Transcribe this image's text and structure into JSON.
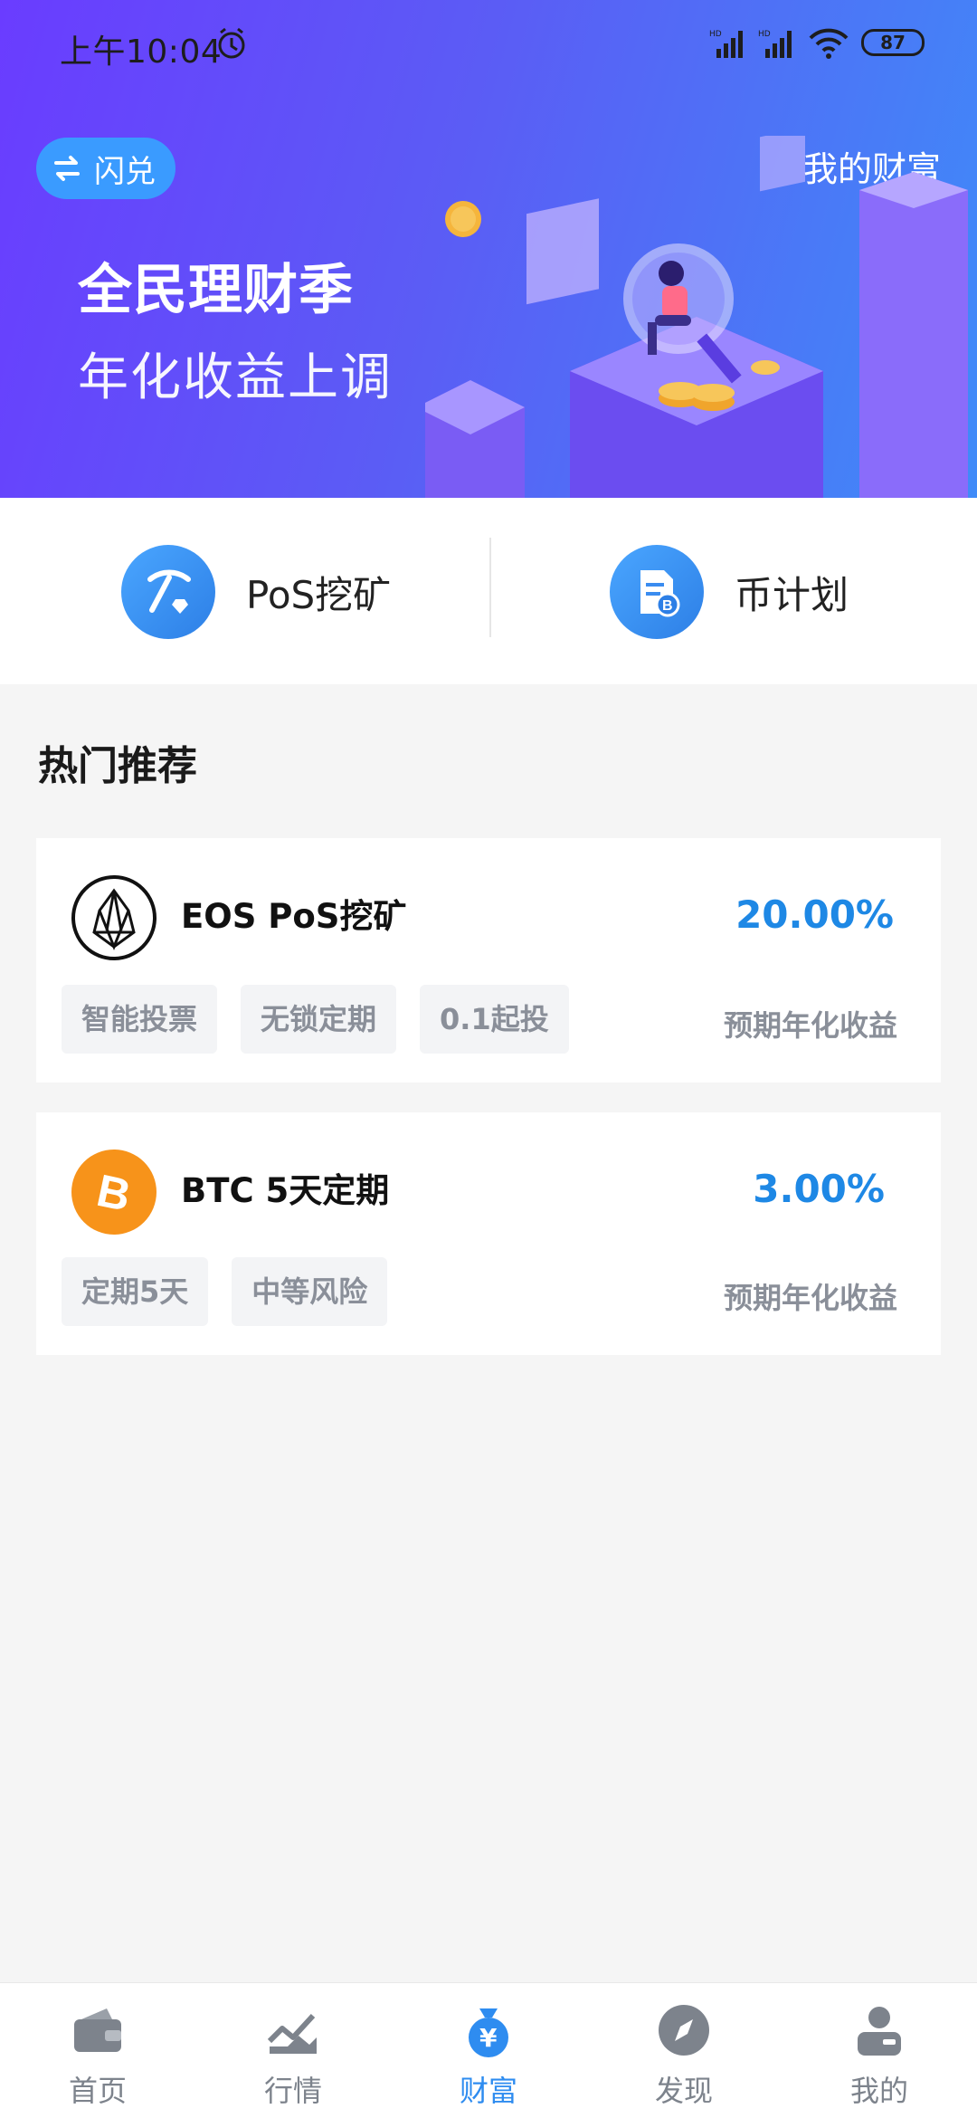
{
  "status_bar": {
    "time": "上午10:04",
    "battery": "87"
  },
  "banner": {
    "flash_button": "闪兑",
    "my_wealth_link": "我的财富",
    "title": "全民理财季",
    "subtitle": "年化收益上调"
  },
  "quick_actions": [
    {
      "label": "PoS挖矿",
      "icon": "pickaxe-icon"
    },
    {
      "label": "币计划",
      "icon": "bitcoin-document-icon"
    }
  ],
  "section": {
    "title": "热门推荐"
  },
  "products": [
    {
      "name": "EOS PoS挖矿",
      "rate": "20.00%",
      "note": "预期年化收益",
      "logo": "eos-logo",
      "tags": [
        "智能投票",
        "无锁定期",
        "0.1起投"
      ]
    },
    {
      "name": "BTC 5天定期",
      "rate": "3.00%",
      "note": "预期年化收益",
      "logo": "bitcoin-logo",
      "tags": [
        "定期5天",
        "中等风险"
      ]
    }
  ],
  "tabbar": {
    "active": "财富",
    "tabs": [
      {
        "label": "首页",
        "icon": "wallet-icon"
      },
      {
        "label": "行情",
        "icon": "chart-icon"
      },
      {
        "label": "财富",
        "icon": "money-bag-icon"
      },
      {
        "label": "发现",
        "icon": "compass-icon"
      },
      {
        "label": "我的",
        "icon": "profile-icon"
      }
    ]
  },
  "colors": {
    "accent": "#1e88e5",
    "banner_start": "#6a3cff",
    "banner_end": "#3f8bf8",
    "tag_text": "#8a8f99"
  }
}
